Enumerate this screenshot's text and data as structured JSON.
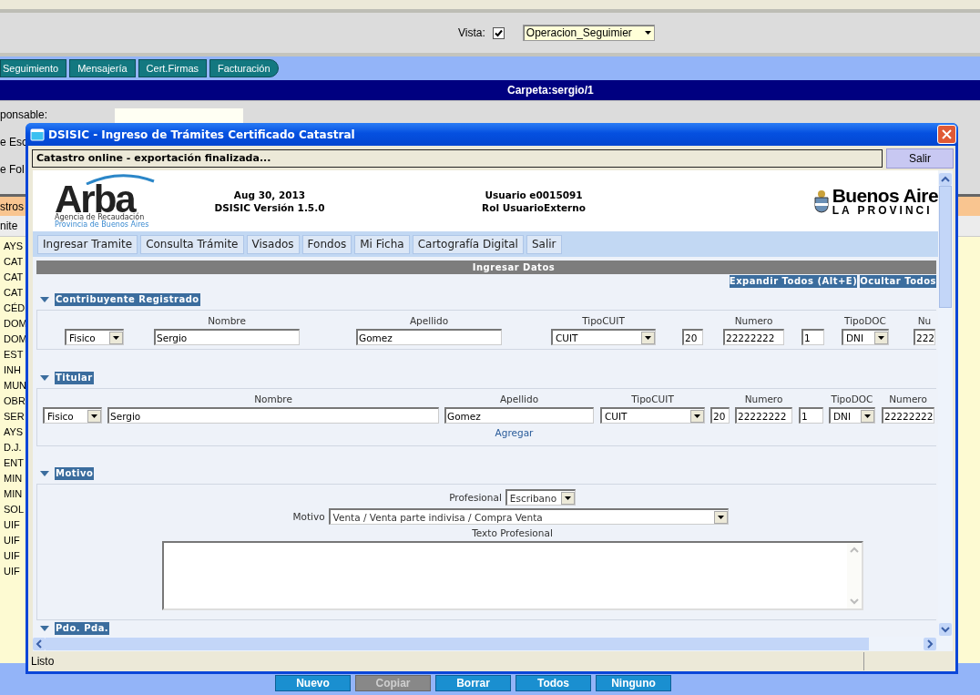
{
  "toolbar": {
    "vista_label": "Vista:",
    "vista_checked": true,
    "vista_select": "Operacion_Seguimier"
  },
  "nav_tabs": [
    "Seguimiento",
    "Mensajería",
    "Cert.Firmas",
    "Facturación"
  ],
  "folder_bar": "Carpeta:sergio/1",
  "form_labels": [
    "ponsable:",
    "e Esc",
    "e Fol"
  ],
  "list": {
    "header": "stros",
    "column": "nite",
    "items": [
      "AYS",
      "CAT",
      "CAT",
      "CAT",
      "CÉD",
      "DOM",
      "DOM",
      "EST",
      "INH",
      "MUN",
      "OBR",
      "SER",
      "AYS",
      "D.J.",
      "ENT",
      "MIN",
      "MIN",
      "SOL",
      "UIF",
      "UIF",
      "UIF",
      "UIF"
    ]
  },
  "dialog": {
    "title": "DSISIC - Ingreso de Trámites Certificado Catastral",
    "status_message": "Catastro online - exportación finalizada...",
    "exit_button": "Salir",
    "header": {
      "logo": "Arba",
      "logo_subtitle": [
        "Agencia de Recaudación",
        "Provincia de Buenos Aires"
      ],
      "date": "Aug 30, 2013",
      "version": "DSISIC Versión 1.5.0",
      "user": "Usuario e0015091",
      "role": "Rol UsuarioExterno",
      "brand": "Buenos Aire",
      "brand_sub": "LA PROVINCI"
    },
    "menu": [
      "Ingresar Tramite",
      "Consulta Trámite",
      "Visados",
      "Fondos",
      "Mi Ficha",
      "Cartografía Digital",
      "Salir"
    ],
    "band": "Ingresar Datos",
    "links": [
      "Expandir Todos (Alt+E)",
      "Ocultar Todos"
    ],
    "sections": [
      {
        "title": "Contribuyente Registrado",
        "expanded": true,
        "kind": "persona",
        "fields": [
          {
            "kind": "select",
            "value": "Fisico"
          },
          {
            "kind": "input",
            "label": "Nombre",
            "value": "Sergio"
          },
          {
            "kind": "input",
            "label": "Apellido",
            "value": "Gomez"
          },
          {
            "kind": "select",
            "label": "TipoCUIT",
            "value": "CUIT"
          },
          {
            "kind": "input",
            "value": "20"
          },
          {
            "kind": "input",
            "label": "Numero",
            "value": "22222222"
          },
          {
            "kind": "input",
            "value": "1"
          },
          {
            "kind": "select",
            "label": "TipoDOC",
            "value": "DNI"
          },
          {
            "kind": "input",
            "label": "Nu",
            "value": "222"
          }
        ]
      },
      {
        "title": "Titular",
        "expanded": true,
        "kind": "persona",
        "link": "Agregar",
        "fields": [
          {
            "kind": "select",
            "value": "Fisico"
          },
          {
            "kind": "input",
            "label": "Nombre",
            "value": "Sergio"
          },
          {
            "kind": "input",
            "label": "Apellido",
            "value": "Gomez"
          },
          {
            "kind": "select",
            "label": "TipoCUIT",
            "value": "CUIT"
          },
          {
            "kind": "input",
            "value": "20"
          },
          {
            "kind": "input",
            "label": "Numero",
            "value": "22222222"
          },
          {
            "kind": "input",
            "value": "1"
          },
          {
            "kind": "select",
            "label": "TipoDOC",
            "value": "DNI"
          },
          {
            "kind": "input",
            "label": "Numero",
            "value": "22222222"
          }
        ]
      },
      {
        "title": "Motivo",
        "expanded": true,
        "kind": "motivo",
        "profesional_label": "Profesional",
        "profesional": "Escribano",
        "motivo_label": "Motivo",
        "motivo": "Venta / Venta parte indivisa / Compra Venta",
        "texto_label": "Texto Profesional"
      },
      {
        "title": "Pdo. Pda.",
        "expanded": true,
        "kind": "header"
      }
    ],
    "status_bar": "Listo"
  },
  "buttons": [
    {
      "label": "Nuevo",
      "disabled": false
    },
    {
      "label": "Copiar",
      "disabled": true
    },
    {
      "label": "Borrar",
      "disabled": false
    },
    {
      "label": "Todos",
      "disabled": false
    },
    {
      "label": "Ninguno",
      "disabled": false
    }
  ]
}
